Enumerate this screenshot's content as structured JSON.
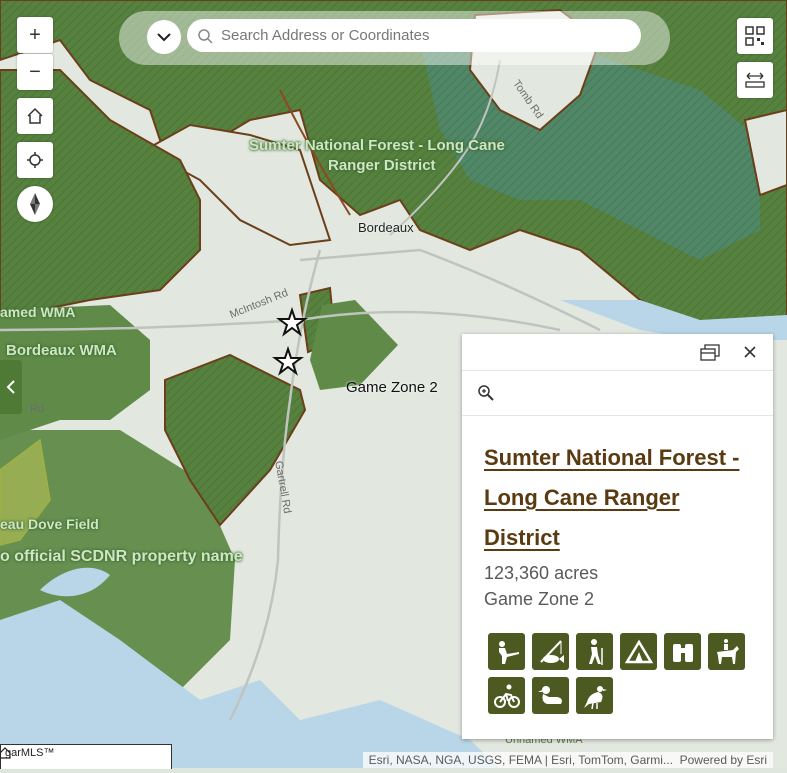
{
  "search": {
    "placeholder": "Search Address or Coordinates"
  },
  "controls": {
    "zoom_in": "+",
    "zoom_out": "−"
  },
  "map_labels": {
    "forest_name": "Sumter National Forest - Long Cane",
    "forest_name_2": "Ranger District",
    "town": "Bordeaux",
    "wma_1": "amed WMA",
    "wma_2": "Bordeaux WMA",
    "dove_field": "eau Dove Field",
    "scdnr": "o official SCDNR property name",
    "game_zone": "Game Zone 2",
    "road_mcintosh": "McIntosh Rd",
    "road_tomb": "Tomb Rd",
    "road_gartrell": "Gartrell Rd",
    "road_rd": "Rd",
    "unnamed_wma": "Unnamed WMA"
  },
  "popup": {
    "title_line1": "Sumter National Forest -",
    "title_line2": "Long Cane Ranger",
    "title_line3": "District",
    "acres": "123,360 acres",
    "zone": "Game Zone 2",
    "activities": [
      "hunting-icon",
      "fishing-icon",
      "hiking-icon",
      "camping-icon",
      "wildlife-viewing-icon",
      "horseback-riding-icon",
      "biking-icon",
      "waterfowl-icon",
      "bird-hunting-icon"
    ]
  },
  "footer": {
    "attribution": "Esri, NASA, NGA, USGS, FEMA | Esri, TomTom, Garmi...",
    "powered": "Powered by Esri",
    "logo_text": "garMLS™"
  },
  "colors": {
    "forest": "#56813f",
    "popup_title": "#5a3a10",
    "icon_bg": "#4c5a22"
  }
}
